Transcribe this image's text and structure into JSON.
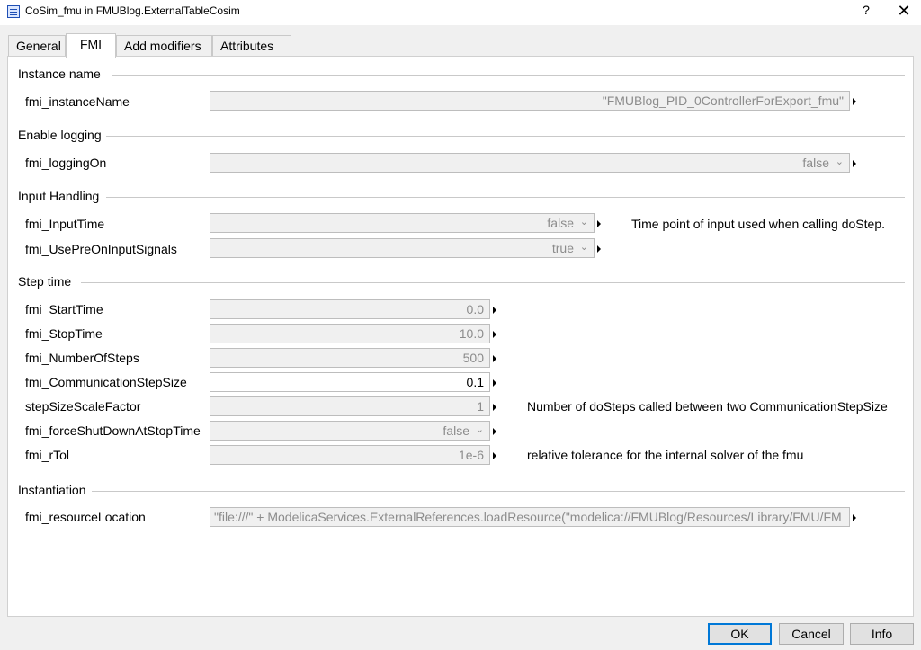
{
  "window": {
    "title": "CoSim_fmu in FMUBlog.ExternalTableCosim",
    "help_label": "?",
    "close_label": "✕"
  },
  "tabs": [
    {
      "label": "General"
    },
    {
      "label": "FMI",
      "active": true
    },
    {
      "label": "Add modifiers"
    },
    {
      "label": "Attributes"
    }
  ],
  "sections": {
    "instance_name": "Instance name",
    "enable_logging": "Enable logging",
    "input_handling": "Input Handling",
    "step_time": "Step time",
    "instantiation": "Instantiation"
  },
  "params": {
    "instance_name": {
      "label": "fmi_instanceName",
      "value": "\"FMUBlog_PID_0ControllerForExport_fmu\""
    },
    "logging_on": {
      "label": "fmi_loggingOn",
      "value": "false"
    },
    "input_time": {
      "label": "fmi_InputTime",
      "value": "false",
      "description": "Time point of input used when calling doStep."
    },
    "use_pre": {
      "label": "fmi_UsePreOnInputSignals",
      "value": "true"
    },
    "start_time": {
      "label": "fmi_StartTime",
      "value": "0.0"
    },
    "stop_time": {
      "label": "fmi_StopTime",
      "value": "10.0"
    },
    "number_of_steps": {
      "label": "fmi_NumberOfSteps",
      "value": "500"
    },
    "comm_step_size": {
      "label": "fmi_CommunicationStepSize",
      "value": "0.1"
    },
    "step_scale": {
      "label": "stepSizeScaleFactor",
      "value": "1",
      "description": "Number of doSteps called between two CommunicationStepSize"
    },
    "force_shutdown": {
      "label": "fmi_forceShutDownAtStopTime",
      "value": "false"
    },
    "rtol": {
      "label": "fmi_rTol",
      "value": "1e-6",
      "description": "relative tolerance for the internal solver of the fmu"
    },
    "resource_location": {
      "label": "fmi_resourceLocation",
      "value": "\"file:///\" + ModelicaServices.ExternalReferences.loadResource(\"modelica://FMUBlog/Resources/Library/FMU/FM"
    }
  },
  "buttons": {
    "ok": "OK",
    "cancel": "Cancel",
    "info": "Info"
  },
  "colors": {
    "accent": "#0078d7",
    "panel": "#ffffff",
    "background": "#f0f0f0"
  },
  "icons": {
    "app": "model-window-icon",
    "chevron": "chevron-down-icon",
    "menu_arrow": "triangle-right-icon"
  }
}
